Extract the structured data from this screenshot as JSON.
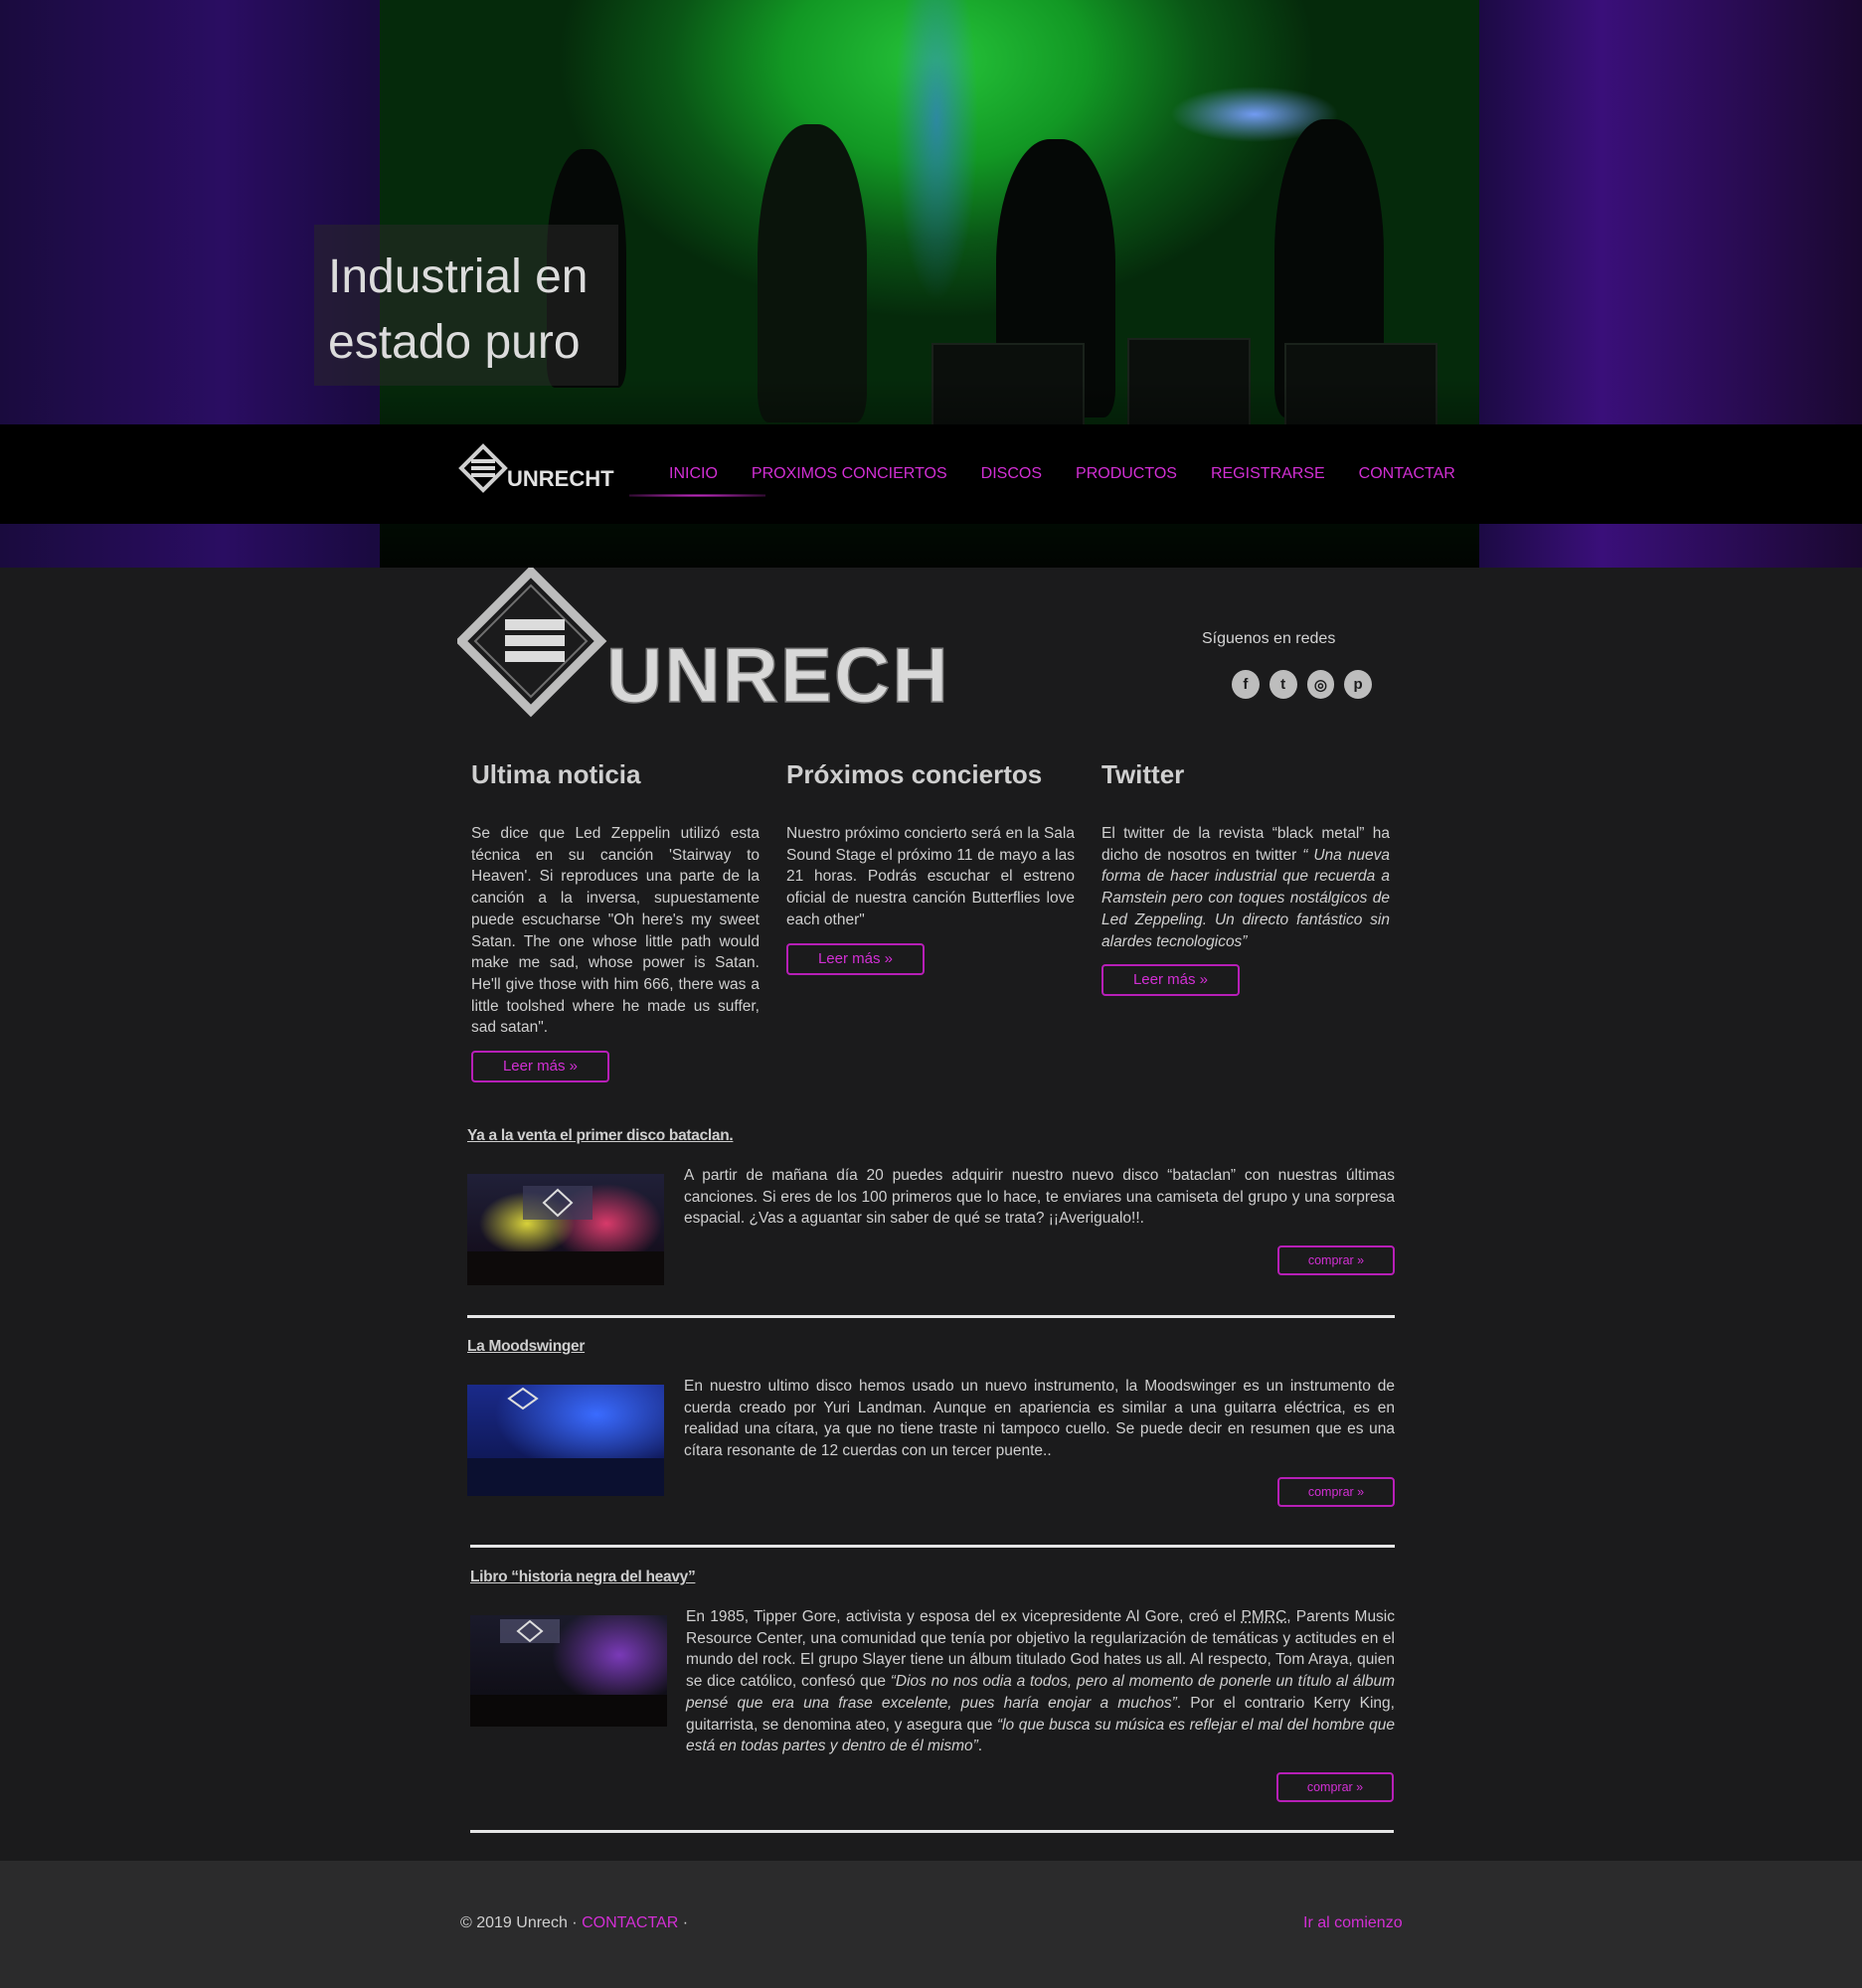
{
  "hero": {
    "caption": "Industrial en estado puro"
  },
  "brand": {
    "logo_text": "UNRECHT"
  },
  "nav": {
    "items": [
      {
        "label": "INICIO",
        "active": true
      },
      {
        "label": "PROXIMOS CONCIERTOS"
      },
      {
        "label": "DISCOS"
      },
      {
        "label": "PRODUCTOS"
      },
      {
        "label": "REGISTRARSE"
      },
      {
        "label": "CONTACTAR"
      }
    ]
  },
  "social": {
    "title": "Síguenos en redes",
    "icons": [
      "facebook-icon",
      "twitter-icon",
      "instagram-icon",
      "pinterest-icon"
    ]
  },
  "columns": [
    {
      "title": "Ultima noticia",
      "text": "Se dice que Led Zeppelin utilizó esta técnica en su canción 'Stairway to Heaven'. Si reproduces una parte de la canción a la inversa, supuestamente puede escucharse \"Oh here's my sweet Satan. The one whose little path would make me sad, whose power is Satan. He'll give those with him 666, there was a little toolshed where he made us suffer, sad satan\".",
      "button": "Leer más »"
    },
    {
      "title": "Próximos conciertos",
      "text": "Nuestro próximo concierto será en la Sala Sound Stage el próximo 11 de mayo a las 21 horas. Podrás escuchar el estreno oficial de nuestra canción Butterflies love each other\"",
      "button": "Leer más »"
    },
    {
      "title": "Twitter",
      "text_plain": "El twitter de la revista “black metal” ha dicho de nosotros en twitter ",
      "text_italic": "“ Una nueva forma de hacer industrial que recuerda a Ramstein pero con toques nostálgicos de Led Zeppeling. Un directo fantástico sin alardes tecnologicos”",
      "button": "Leer más »"
    }
  ],
  "news": [
    {
      "title": "Ya a la venta el primer disco bataclan.",
      "text": "A partir de mañana día 20 puedes adquirir nuestro nuevo disco “bataclan” con nuestras últimas canciones. Si eres de los 100 primeros que lo hace, te enviares una camiseta del grupo y una sorpresa espacial. ¿Vas a aguantar sin saber de qué se trata? ¡¡Averigualo!!.",
      "button": "comprar »"
    },
    {
      "title": "La Moodswinger",
      "text": "En nuestro ultimo disco hemos usado un nuevo instrumento, la Moodswinger es un instrumento de cuerda creado por Yuri Landman. Aunque en apariencia es similar a una guitarra eléctrica, es en realidad una cítara, ya que no tiene traste ni tampoco cuello. Se puede decir en resumen que es una cítara resonante de 12 cuerdas con un tercer puente..",
      "button": "comprar »"
    },
    {
      "title": "Libro “historia negra del heavy”",
      "t1": "En 1985, Tipper Gore, activista y esposa del ex vicepresidente Al Gore, creó el ",
      "abbr": "PMRC",
      "t2": ", Parents Music Resource Center, una comunidad que tenía por objetivo la regularización de temáticas y actitudes en el mundo del rock. El grupo Slayer tiene un álbum titulado God hates us all. Al respecto, Tom Araya, quien se dice católico, confesó que ",
      "i1": "“Dios no nos odia a todos, pero al momento de ponerle un título al álbum pensé que era una frase excelente, pues haría enojar a muchos”",
      "t3": ". Por el contrario Kerry King, guitarrista, se denomina ateo, y asegura que ",
      "i2": "“lo que busca su música es reflejar el mal del hombre que está en todas partes y dentro de él mismo”",
      "t4": ".",
      "button": "comprar »"
    }
  ],
  "footer": {
    "copyright": "© 2019 Unrech · ",
    "contact": "CONTACTAR",
    "sep": " ·",
    "top_link": "Ir al comienzo"
  },
  "colors": {
    "accent": "#d22fd4",
    "background": "#1b1b1c",
    "footer": "#2b2b2c"
  }
}
